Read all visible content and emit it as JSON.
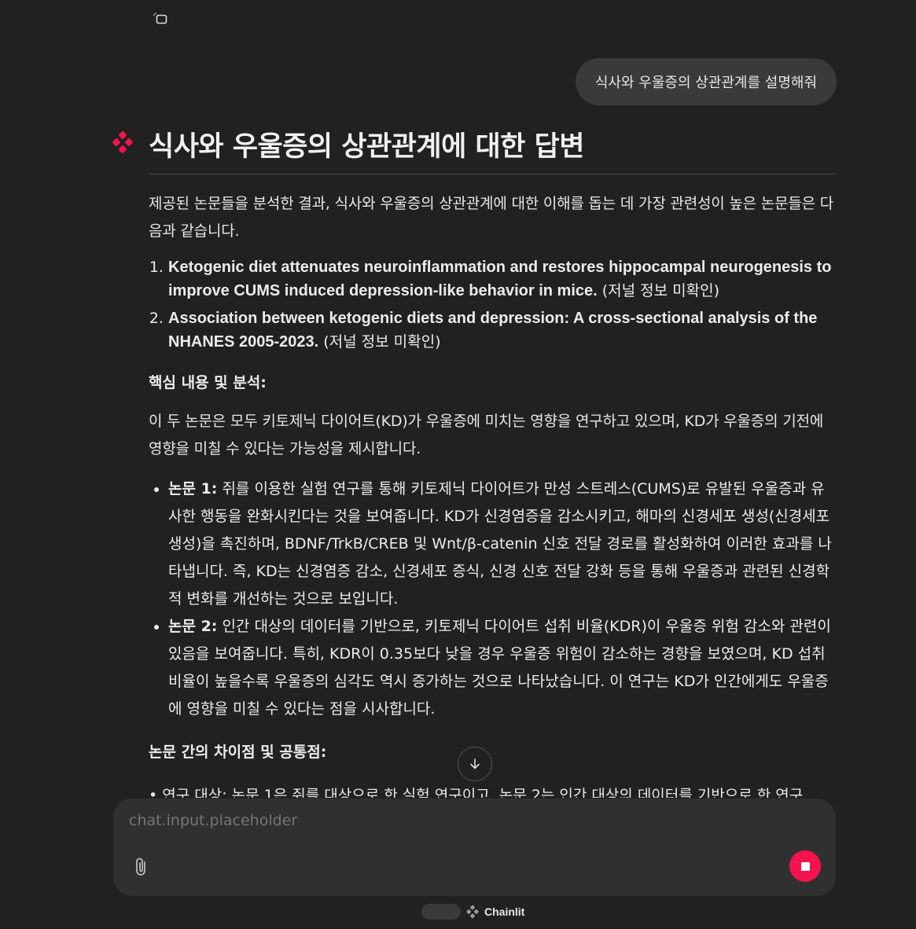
{
  "top_toolbar": {
    "icon": "new-chat-icon"
  },
  "user_message": {
    "text": "식사와 우울증의 상관관계를 설명해줘"
  },
  "assistant": {
    "avatar_icon": "chainlit-logo-icon",
    "avatar_color": "#f4134d",
    "title": "식사와 우울증의 상관관계에 대한 답변",
    "intro": "제공된 논문들을 분석한 결과, 식사와 우울증의 상관관계에 대한 이해를 돕는 데 가장 관련성이 높은 논문들은 다음과 같습니다.",
    "papers": [
      {
        "title": "Ketogenic diet attenuates neuroinflammation and restores hippocampal neurogenesis to improve CUMS induced depression-like behavior in mice.",
        "note": " (저널 정보 미확인)"
      },
      {
        "title": "Association between ketogenic diets and depression: A cross-sectional analysis of the NHANES 2005-2023.",
        "note": " (저널 정보 미확인)"
      }
    ],
    "section1_heading": "핵심 내용 및 분석:",
    "section1_para": "이 두 논문은 모두 키토제닉 다이어트(KD)가 우울증에 미치는 영향을 연구하고 있으며, KD가 우울증의 기전에 영향을 미칠 수 있다는 가능성을 제시합니다.",
    "bullets": [
      {
        "label": "논문 1:",
        "text": " 쥐를 이용한 실험 연구를 통해 키토제닉 다이어트가 만성 스트레스(CUMS)로 유발된 우울증과 유사한 행동을 완화시킨다는 것을 보여줍니다.  KD가 신경염증을 감소시키고, 해마의 신경세포 생성(신경세포 생성)을 촉진하며, BDNF/TrkB/CREB 및 Wnt/β-catenin 신호 전달 경로를 활성화하여 이러한 효과를 나타냅니다. 즉, KD는 신경염증 감소, 신경세포 증식, 신경 신호 전달 강화 등을 통해 우울증과 관련된 신경학적 변화를 개선하는 것으로 보입니다."
      },
      {
        "label": "논문 2:",
        "text": " 인간 대상의 데이터를 기반으로, 키토제닉 다이어트 섭취 비율(KDR)이 우울증 위험 감소와 관련이 있음을 보여줍니다. 특히, KDR이 0.35보다 낮을 경우 우울증 위험이 감소하는 경향을 보였으며, KD 섭취 비율이 높을수록 우울증의 심각도 역시 증가하는 것으로 나타났습니다. 이 연구는 KD가 인간에게도 우울증에 영향을 미칠 수 있다는 점을 시사합니다."
      }
    ],
    "section2_heading": "논문 간의 차이점 및 공통점:",
    "cut_line": "• 연구 대상: 논문 1은 쥐를 대상으로 한 실험 연구이고, 논문 2는 인간 대상의 데이터를 기반으로 한 연구"
  },
  "scroll_button": {
    "icon": "arrow-down-icon"
  },
  "composer": {
    "placeholder": "chat.input.placeholder",
    "attach_icon": "paperclip-icon",
    "stop_icon": "stop-icon",
    "stop_color": "#f4134d"
  },
  "footer": {
    "brand": "Chainlit",
    "logo_icon": "chainlit-logo-icon"
  }
}
